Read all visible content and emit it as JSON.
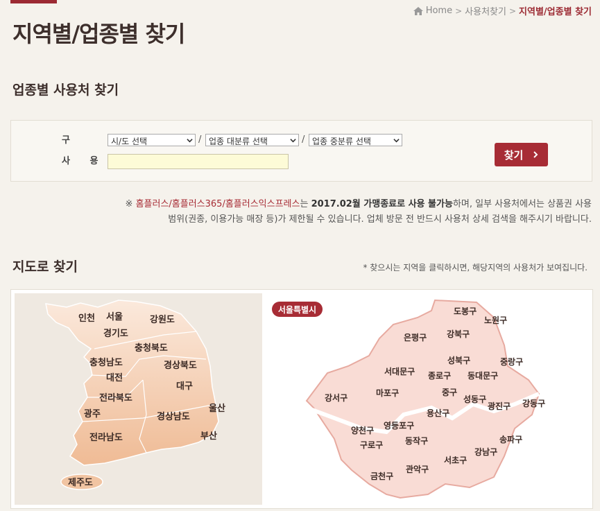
{
  "breadcrumb": {
    "home": "Home",
    "section": "사용처찾기",
    "current": "지역별/업종별 찾기"
  },
  "page_title": "지역별/업종별 찾기",
  "search": {
    "heading": "업종별 사용처 찾기",
    "category_label": "구  분",
    "place_label": "사 용 처",
    "region_select": "시/도 선택",
    "major_select": "업종 대분류 선택",
    "middle_select": "업종 중분류 선택",
    "slash": "/",
    "place_value": "",
    "find_button": "찾기"
  },
  "notice": {
    "prefix": "※ ",
    "brands": "홈플러스/홈플러스365/홈플러스익스프레스",
    "text1": "는 ",
    "bold": "2017.02월 가맹종료로 사용 불가능",
    "text2": "하며, 일부 사용처에서는 상품권 사용",
    "line2": "범위(권종, 이용가능 매장 등)가 제한될 수 있습니다. 업체 방문 전 반드시 사용처 상세 검색을 해주시기 바랍니다."
  },
  "map": {
    "heading": "지도로 찾기",
    "hint": "* 찾으시는 지역을 클릭하시면, 해당지역의 사용처가 보여집니다.",
    "badge": "서울특별시",
    "regions": [
      "인천",
      "서울",
      "강원도",
      "경기도",
      "충청북도",
      "충청남도",
      "경상북도",
      "대전",
      "대구",
      "전라북도",
      "울산",
      "광주",
      "경상남도",
      "부산",
      "전라남도",
      "제주도"
    ],
    "districts": [
      "도봉구",
      "노원구",
      "은평구",
      "강북구",
      "성북구",
      "중랑구",
      "서대문구",
      "종로구",
      "동대문구",
      "강서구",
      "마포구",
      "중구",
      "성동구",
      "광진구",
      "강동구",
      "용산구",
      "양천구",
      "영등포구",
      "구로구",
      "동작구",
      "송파구",
      "강남구",
      "서초구",
      "금천구",
      "관악구"
    ]
  },
  "colors": {
    "accent": "#a72c35",
    "map_fill": "#f6d4cc",
    "input_bg": "#fdfbd7"
  }
}
